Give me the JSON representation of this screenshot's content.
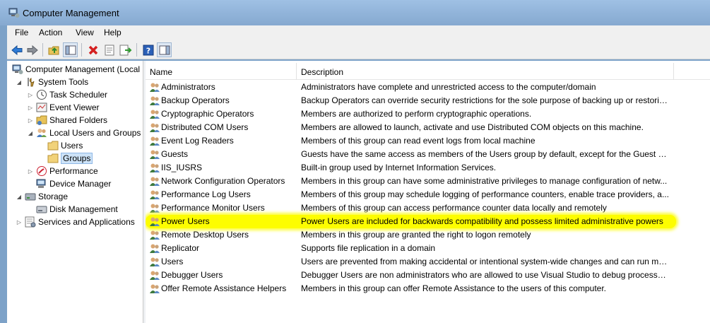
{
  "window": {
    "title": "Computer Management",
    "icon": "computer-management-icon"
  },
  "menu": [
    "File",
    "Action",
    "View",
    "Help"
  ],
  "toolbar": [
    {
      "name": "back-arrow-icon"
    },
    {
      "name": "forward-arrow-icon"
    },
    {
      "name": "up-folder-icon"
    },
    {
      "name": "show-hide-tree-icon"
    },
    {
      "name": "delete-icon"
    },
    {
      "name": "properties-icon"
    },
    {
      "name": "export-list-icon"
    },
    {
      "name": "help-icon"
    },
    {
      "name": "show-hide-action-pane-icon"
    }
  ],
  "tree": [
    {
      "label": "Computer Management (Local",
      "icon": "computer-management-icon",
      "arrow": ""
    },
    {
      "label": "System Tools",
      "icon": "tools-icon",
      "arrow": "expanded"
    },
    {
      "label": "Task Scheduler",
      "icon": "clock-icon",
      "arrow": "collapsed"
    },
    {
      "label": "Event Viewer",
      "icon": "event-viewer-icon",
      "arrow": "collapsed"
    },
    {
      "label": "Shared Folders",
      "icon": "shared-folder-icon",
      "arrow": "collapsed"
    },
    {
      "label": "Local Users and Groups",
      "icon": "users-icon",
      "arrow": "expanded"
    },
    {
      "label": "Users",
      "icon": "folder-icon",
      "arrow": ""
    },
    {
      "label": "Groups",
      "icon": "folder-icon",
      "arrow": "",
      "selected": true
    },
    {
      "label": "Performance",
      "icon": "performance-icon",
      "arrow": "collapsed"
    },
    {
      "label": "Device Manager",
      "icon": "device-manager-icon",
      "arrow": ""
    },
    {
      "label": "Storage",
      "icon": "storage-icon",
      "arrow": "expanded"
    },
    {
      "label": "Disk Management",
      "icon": "disk-icon",
      "arrow": ""
    },
    {
      "label": "Services and Applications",
      "icon": "services-icon",
      "arrow": "collapsed"
    }
  ],
  "list": {
    "columns": [
      "Name",
      "Description"
    ],
    "rows": [
      {
        "name": "Administrators",
        "description": "Administrators have complete and unrestricted access to the computer/domain"
      },
      {
        "name": "Backup Operators",
        "description": "Backup Operators can override security restrictions for the sole purpose of backing up or restorin..."
      },
      {
        "name": "Cryptographic Operators",
        "description": "Members are authorized to perform cryptographic operations."
      },
      {
        "name": "Distributed COM Users",
        "description": "Members are allowed to launch, activate and use Distributed COM objects on this machine."
      },
      {
        "name": "Event Log Readers",
        "description": "Members of this group can read event logs from local machine"
      },
      {
        "name": "Guests",
        "description": "Guests have the same access as members of the Users group by default, except for the Guest acc..."
      },
      {
        "name": "IIS_IUSRS",
        "description": "Built-in group used by Internet Information Services."
      },
      {
        "name": "Network Configuration Operators",
        "description": "Members in this group can have some administrative privileges to manage configuration of netw..."
      },
      {
        "name": "Performance Log Users",
        "description": "Members of this group may schedule logging of performance counters, enable trace providers, a..."
      },
      {
        "name": "Performance Monitor Users",
        "description": "Members of this group can access performance counter data locally and remotely"
      },
      {
        "name": "Power Users",
        "description": "Power Users are included for backwards compatibility and possess limited administrative powers",
        "highlighted": true
      },
      {
        "name": "Remote Desktop Users",
        "description": "Members in this group are granted the right to logon remotely"
      },
      {
        "name": "Replicator",
        "description": "Supports file replication in a domain"
      },
      {
        "name": "Users",
        "description": "Users are prevented from making accidental or intentional system-wide changes and can run mo..."
      },
      {
        "name": "Debugger Users",
        "description": "Debugger Users are non administrators who are allowed to use Visual Studio to debug processes, ..."
      },
      {
        "name": "Offer Remote Assistance Helpers",
        "description": "Members in this group can offer Remote Assistance to the users of this computer."
      }
    ]
  },
  "colors": {
    "highlight": "#fdfd00",
    "selection": "#cde3f8"
  }
}
